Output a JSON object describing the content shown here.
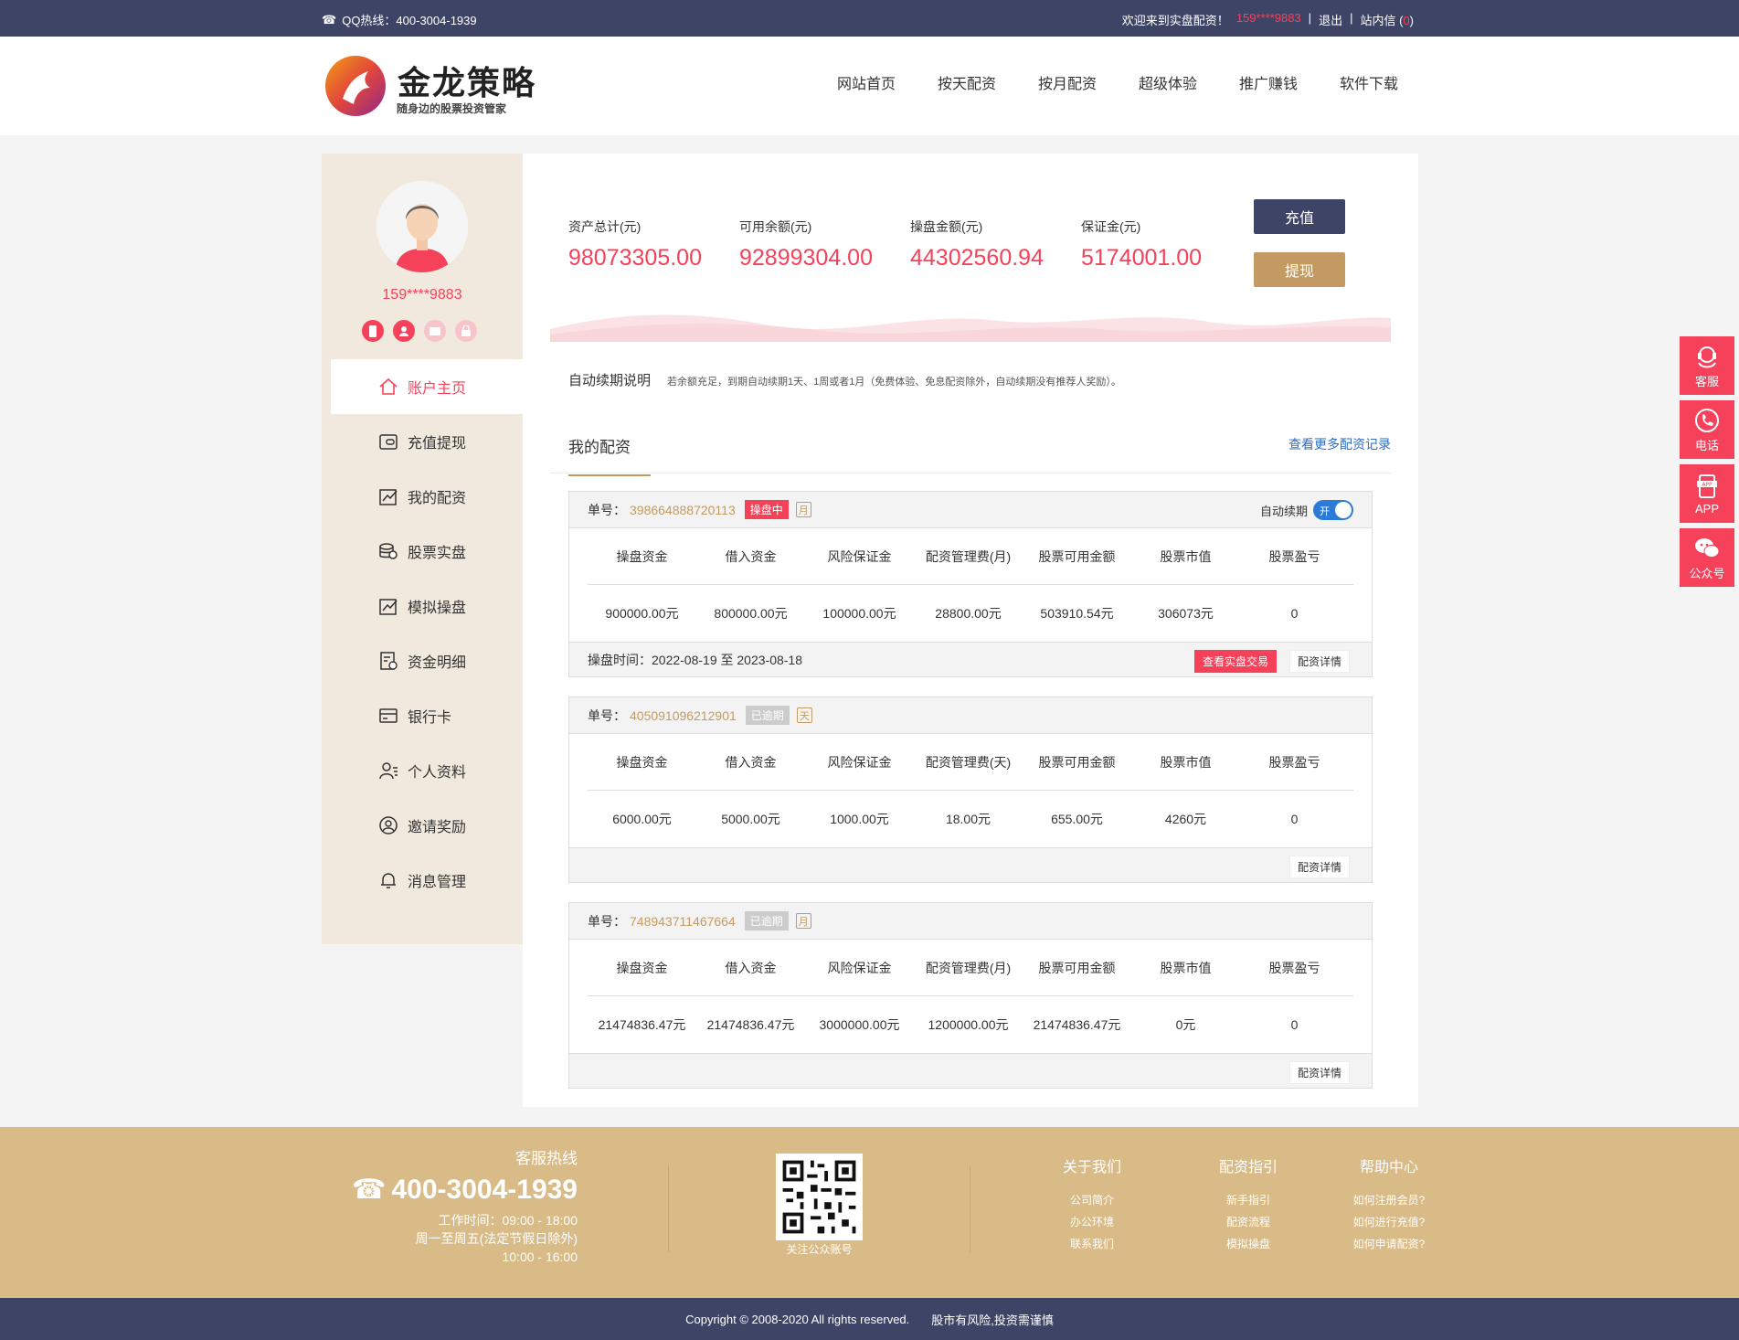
{
  "topbar": {
    "hotline": "QQ热线：400-3004-1939",
    "welcome": "欢迎来到实盘配资！",
    "user": "159****9883",
    "sep1": "|",
    "logout": "退出",
    "sep2": "|",
    "msg_prefix": "站内信 (",
    "msg_count": "0",
    "msg_suffix": ")"
  },
  "logo": {
    "title": "金龙策略",
    "subtitle": "随身边的股票投资管家"
  },
  "nav": [
    "网站首页",
    "按天配资",
    "按月配资",
    "超级体验",
    "推广赚钱",
    "软件下载"
  ],
  "user": {
    "name": "159****9883"
  },
  "menu": [
    "账户主页",
    "充值提现",
    "我的配资",
    "股票实盘",
    "模拟操盘",
    "资金明细",
    "银行卡",
    "个人资料",
    "邀请奖励",
    "消息管理"
  ],
  "stats": [
    {
      "label": "资产总计(元)",
      "value": "98073305.00"
    },
    {
      "label": "可用余额(元)",
      "value": "92899304.00"
    },
    {
      "label": "操盘金额(元)",
      "value": "44302560.94"
    },
    {
      "label": "保证金(元)",
      "value": "5174001.00"
    }
  ],
  "actions": {
    "recharge": "充值",
    "withdraw": "提现"
  },
  "auto_renew": {
    "title": "自动续期说明",
    "note": "若余额充足，到期自动续期1天、1周或者1月（免费体验、免息配资除外，自动续期没有推荐人奖励）。"
  },
  "my": {
    "title": "我的配资",
    "more": "查看更多配资记录"
  },
  "labels": {
    "order_no": "单号：",
    "auto": "自动续期",
    "switch_on": "开",
    "detail": "配资详情",
    "view_trade": "查看实盘交易"
  },
  "cards": [
    {
      "no": "398664888720113",
      "status": "操盘中",
      "unit": "月",
      "headers": [
        "操盘资金",
        "借入资金",
        "风险保证金",
        "配资管理费(月)",
        "股票可用金额",
        "股票市值",
        "股票盈亏"
      ],
      "values": [
        "900000.00元",
        "800000.00元",
        "100000.00元",
        "28800.00元",
        "503910.54元",
        "306073元",
        "0"
      ],
      "time": "操盘时间：2022-08-19 至 2023-08-18"
    },
    {
      "no": "405091096212901",
      "status": "已逾期",
      "unit": "天",
      "headers": [
        "操盘资金",
        "借入资金",
        "风险保证金",
        "配资管理费(天)",
        "股票可用金额",
        "股票市值",
        "股票盈亏"
      ],
      "values": [
        "6000.00元",
        "5000.00元",
        "1000.00元",
        "18.00元",
        "655.00元",
        "4260元",
        "0"
      ],
      "time": ""
    },
    {
      "no": "748943711467664",
      "status": "已逾期",
      "unit": "月",
      "headers": [
        "操盘资金",
        "借入资金",
        "风险保证金",
        "配资管理费(月)",
        "股票可用金额",
        "股票市值",
        "股票盈亏"
      ],
      "values": [
        "21474836.47元",
        "21474836.47元",
        "3000000.00元",
        "1200000.00元",
        "21474836.47元",
        "0元",
        "0"
      ],
      "time": ""
    }
  ],
  "float": [
    "客服",
    "电话",
    "APP",
    "公众号"
  ],
  "footer": {
    "hotline_title": "客服热线",
    "phone": "400-3004-1939",
    "hours1": "工作时间：09:00 - 18:00",
    "hours2": "周一至周五(法定节假日除外)",
    "hours3": "10:00 - 16:00",
    "qr_label": "关注公众账号",
    "cols": [
      {
        "title": "关于我们",
        "links": [
          "公司简介",
          "办公环境",
          "联系我们"
        ]
      },
      {
        "title": "配资指引",
        "links": [
          "新手指引",
          "配资流程",
          "模拟操盘"
        ]
      },
      {
        "title": "帮助中心",
        "links": [
          "如何注册会员?",
          "如何进行充值?",
          "如何申请配资?"
        ]
      }
    ]
  },
  "copyright": {
    "text": "Copyright © 2008-2020 All rights reserved.",
    "risk": "股市有风险,投资需谨慎"
  },
  "colors": {
    "accent": "#f5425a",
    "navy": "#3e4466",
    "gold": "#c39b62",
    "footer": "#d9bb88"
  }
}
